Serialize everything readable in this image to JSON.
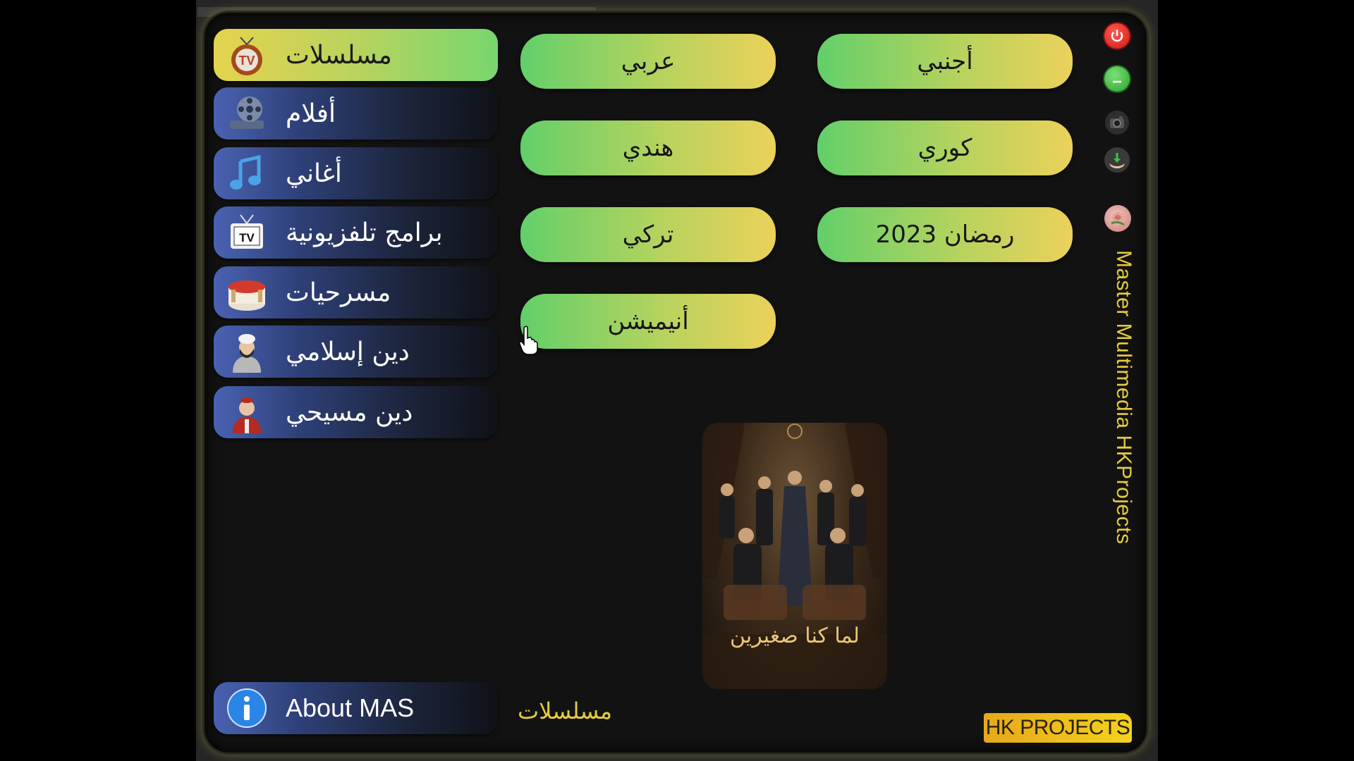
{
  "sidebar": {
    "items": [
      {
        "label": "مسلسلات",
        "icon": "tv-series-icon"
      },
      {
        "label": "أفلام",
        "icon": "film-reel-icon"
      },
      {
        "label": "أغاني",
        "icon": "music-note-icon"
      },
      {
        "label": "برامج تلفزيونية",
        "icon": "retro-tv-icon"
      },
      {
        "label": "مسرحيات",
        "icon": "theater-stage-icon"
      },
      {
        "label": "دين إسلامي",
        "icon": "sheikh-icon"
      },
      {
        "label": "دين مسيحي",
        "icon": "priest-icon"
      }
    ],
    "active_index": 0,
    "about_label": "About MAS",
    "about_icon": "info-icon"
  },
  "categories": [
    "أجنبي",
    "عربي",
    "كوري",
    "هندي",
    "رمضان 2023",
    "تركي",
    "أنيميشن"
  ],
  "controls": {
    "power_icon": "power-icon",
    "minimize_icon": "minimize-icon",
    "camera_icon": "camera-icon",
    "download_icon": "download-icon",
    "profile_icon": "rose-avatar-icon"
  },
  "brand": {
    "vertical_title": "Master Multimedia HKProjects",
    "logo_text": "HK PROJECTS"
  },
  "main": {
    "current_section": "مسلسلات",
    "poster_title": "لما كنا صغيرين"
  },
  "colors": {
    "accent_yellow": "#e6cc3c",
    "button_green": "#62cf6a",
    "button_yellow": "#ecd15a",
    "nav_blue": "#4a62b2",
    "power_red": "#e02a22"
  }
}
